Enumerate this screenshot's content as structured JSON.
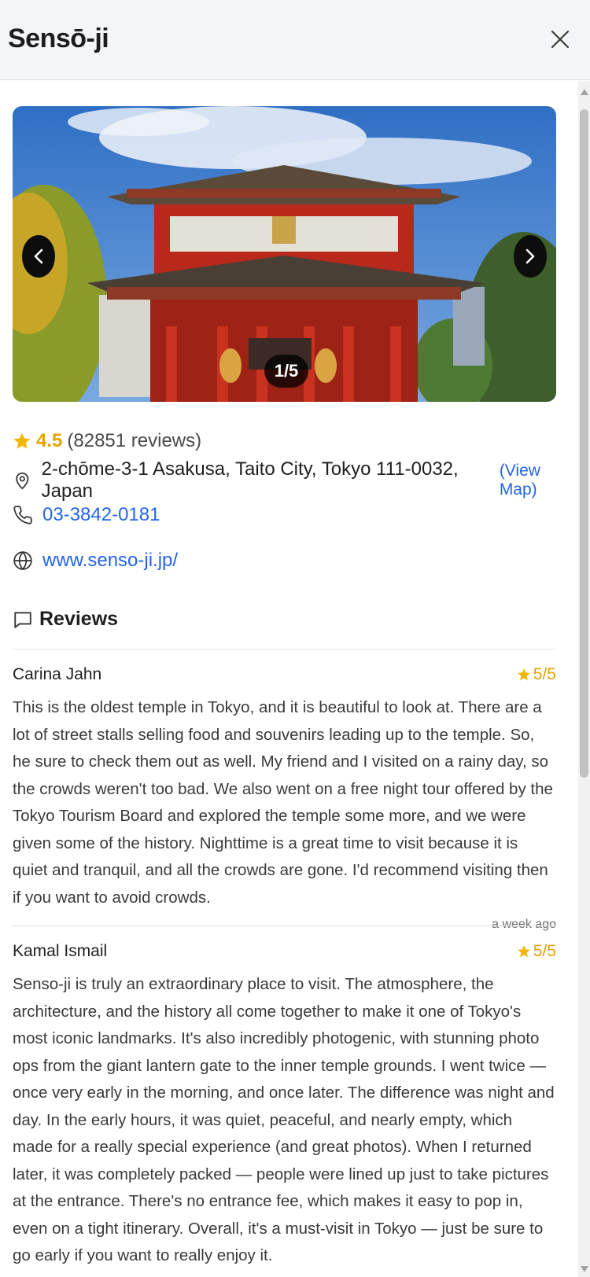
{
  "header": {
    "title": "Sensō-ji",
    "close_label": "close"
  },
  "carousel": {
    "counter": "1/5",
    "current": 1,
    "total": 5
  },
  "rating": {
    "value": "4.5",
    "count": "(82851 reviews)"
  },
  "address": {
    "text": "2-chōme-3-1 Asakusa, Taito City, Tokyo 111-0032, Japan",
    "view_map": "(View Map)"
  },
  "phone": "03-3842-0181",
  "website": "www.senso-ji.jp/",
  "reviews_heading": "Reviews",
  "reviews": [
    {
      "author": "Carina Jahn",
      "score": "5/5",
      "text": "This is the oldest temple in Tokyo, and it is beautiful to look at. There are a lot of street stalls selling food and souvenirs leading up to the temple. So, he sure to check them out as well. My friend and I visited on a rainy day, so the crowds weren't too bad. We also went on a free night tour offered by the Tokyo Tourism Board and explored the temple some more, and we were given some of the history. Nighttime is a great time to visit because it is quiet and tranquil, and all the crowds are gone. I'd recommend visiting then if you want to avoid crowds.",
      "time": "a week ago"
    },
    {
      "author": "Kamal Ismail",
      "score": "5/5",
      "text": "Senso-ji is truly an extraordinary place to visit. The atmosphere, the architecture, and the history all come together to make it one of Tokyo's most iconic landmarks. It's also incredibly photogenic, with stunning photo ops from the giant lantern gate to the inner temple grounds. I went twice — once very early in the morning, and once later. The difference was night and day. In the early hours, it was quiet, peaceful, and nearly empty, which made for a really special experience (and great photos). When I returned later, it was completely packed — people were lined up just to take pictures at the entrance. There's no entrance fee, which makes it easy to pop in, even on a tight itinerary. Overall, it's a must-visit in Tokyo — just be sure to go early if you want to really enjoy it."
    }
  ],
  "colors": {
    "accent_star": "#e8a000",
    "link": "#2563eb",
    "header_bg": "#f4f5f7"
  }
}
